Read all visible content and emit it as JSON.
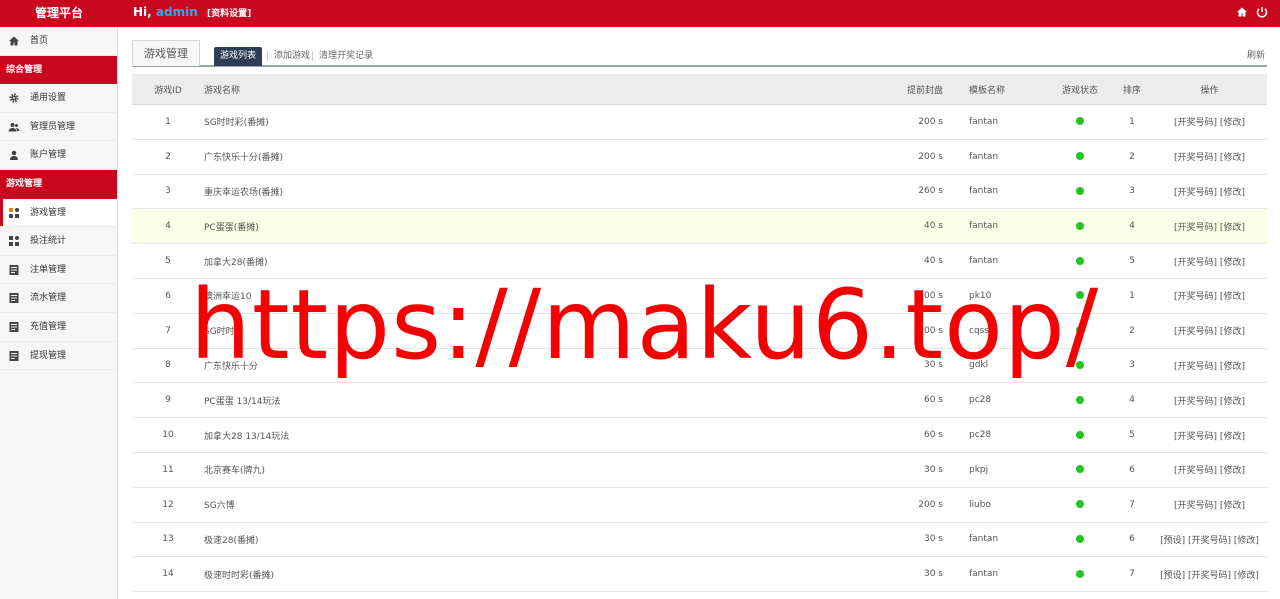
{
  "header": {
    "brand": "管理平台",
    "greeting": "Hi,",
    "username": "admin",
    "profile_link": "[资料设置]",
    "icons": [
      "home-icon",
      "power-icon"
    ]
  },
  "sidebar": {
    "home": {
      "label": "首页",
      "icon": "home-icon"
    },
    "groups": [
      {
        "title": "综合管理",
        "items": [
          {
            "label": "通用设置",
            "icon": "gear-icon"
          },
          {
            "label": "管理员管理",
            "icon": "users-icon"
          },
          {
            "label": "账户管理",
            "icon": "user-icon"
          }
        ]
      },
      {
        "title": "游戏管理",
        "items": [
          {
            "label": "游戏管理",
            "icon": "apps-icon",
            "active": true
          },
          {
            "label": "投注统计",
            "icon": "apps-icon"
          },
          {
            "label": "注单管理",
            "icon": "list-icon"
          },
          {
            "label": "流水管理",
            "icon": "list-icon"
          },
          {
            "label": "充值管理",
            "icon": "list-icon"
          },
          {
            "label": "提现管理",
            "icon": "list-icon"
          }
        ]
      }
    ]
  },
  "tabs": {
    "main": "游戏管理",
    "sub": [
      "游戏列表",
      "添加游戏",
      "清理开奖记录"
    ],
    "refresh": "刷新"
  },
  "table": {
    "headers": [
      "游戏ID",
      "游戏名称",
      "提前封盘",
      "模板名称",
      "游戏状态",
      "排序",
      "操作"
    ],
    "rows": [
      {
        "id": "1",
        "name": "SG时时彩(番摊)",
        "close": "200 s",
        "tpl": "fantan",
        "sort": "1",
        "ops": "[开奖号码] [修改]"
      },
      {
        "id": "2",
        "name": "广东快乐十分(番摊)",
        "close": "200 s",
        "tpl": "fantan",
        "sort": "2",
        "ops": "[开奖号码] [修改]"
      },
      {
        "id": "3",
        "name": "重庆幸运农场(番摊)",
        "close": "260 s",
        "tpl": "fantan",
        "sort": "3",
        "ops": "[开奖号码] [修改]"
      },
      {
        "id": "4",
        "name": "PC蛋蛋(番摊)",
        "close": "40 s",
        "tpl": "fantan",
        "sort": "4",
        "ops": "[开奖号码] [修改]"
      },
      {
        "id": "5",
        "name": "加拿大28(番摊)",
        "close": "40 s",
        "tpl": "fantan",
        "sort": "5",
        "ops": "[开奖号码] [修改]"
      },
      {
        "id": "6",
        "name": "澳洲幸运10",
        "close": "200 s",
        "tpl": "pk10",
        "sort": "1",
        "ops": "[开奖号码] [修改]"
      },
      {
        "id": "7",
        "name": "SG时时彩",
        "close": "200 s",
        "tpl": "cqssc",
        "sort": "2",
        "ops": "[开奖号码] [修改]"
      },
      {
        "id": "8",
        "name": "广东快乐十分",
        "close": "30 s",
        "tpl": "gdkl",
        "sort": "3",
        "ops": "[开奖号码] [修改]"
      },
      {
        "id": "9",
        "name": "PC蛋蛋 13/14玩法",
        "close": "60 s",
        "tpl": "pc28",
        "sort": "4",
        "ops": "[开奖号码] [修改]"
      },
      {
        "id": "10",
        "name": "加拿大28 13/14玩法",
        "close": "60 s",
        "tpl": "pc28",
        "sort": "5",
        "ops": "[开奖号码] [修改]"
      },
      {
        "id": "11",
        "name": "北京赛车(牌九)",
        "close": "30 s",
        "tpl": "pkpj",
        "sort": "6",
        "ops": "[开奖号码] [修改]"
      },
      {
        "id": "12",
        "name": "SG六博",
        "close": "200 s",
        "tpl": "liubo",
        "sort": "7",
        "ops": "[开奖号码] [修改]"
      },
      {
        "id": "13",
        "name": "极速28(番摊)",
        "close": "30 s",
        "tpl": "fantan",
        "sort": "6",
        "ops": "[预设] [开奖号码] [修改]"
      },
      {
        "id": "14",
        "name": "极速时时彩(番摊)",
        "close": "30 s",
        "tpl": "fantan",
        "sort": "7",
        "ops": "[预设] [开奖号码] [修改]"
      }
    ],
    "status_color": "#22c322",
    "highlight_row": "4"
  },
  "watermark": "https://maku6.top/",
  "colors": {
    "brand": "#c8081e",
    "active_tab": "#2d3d55",
    "highlight": "#fcffe8"
  }
}
